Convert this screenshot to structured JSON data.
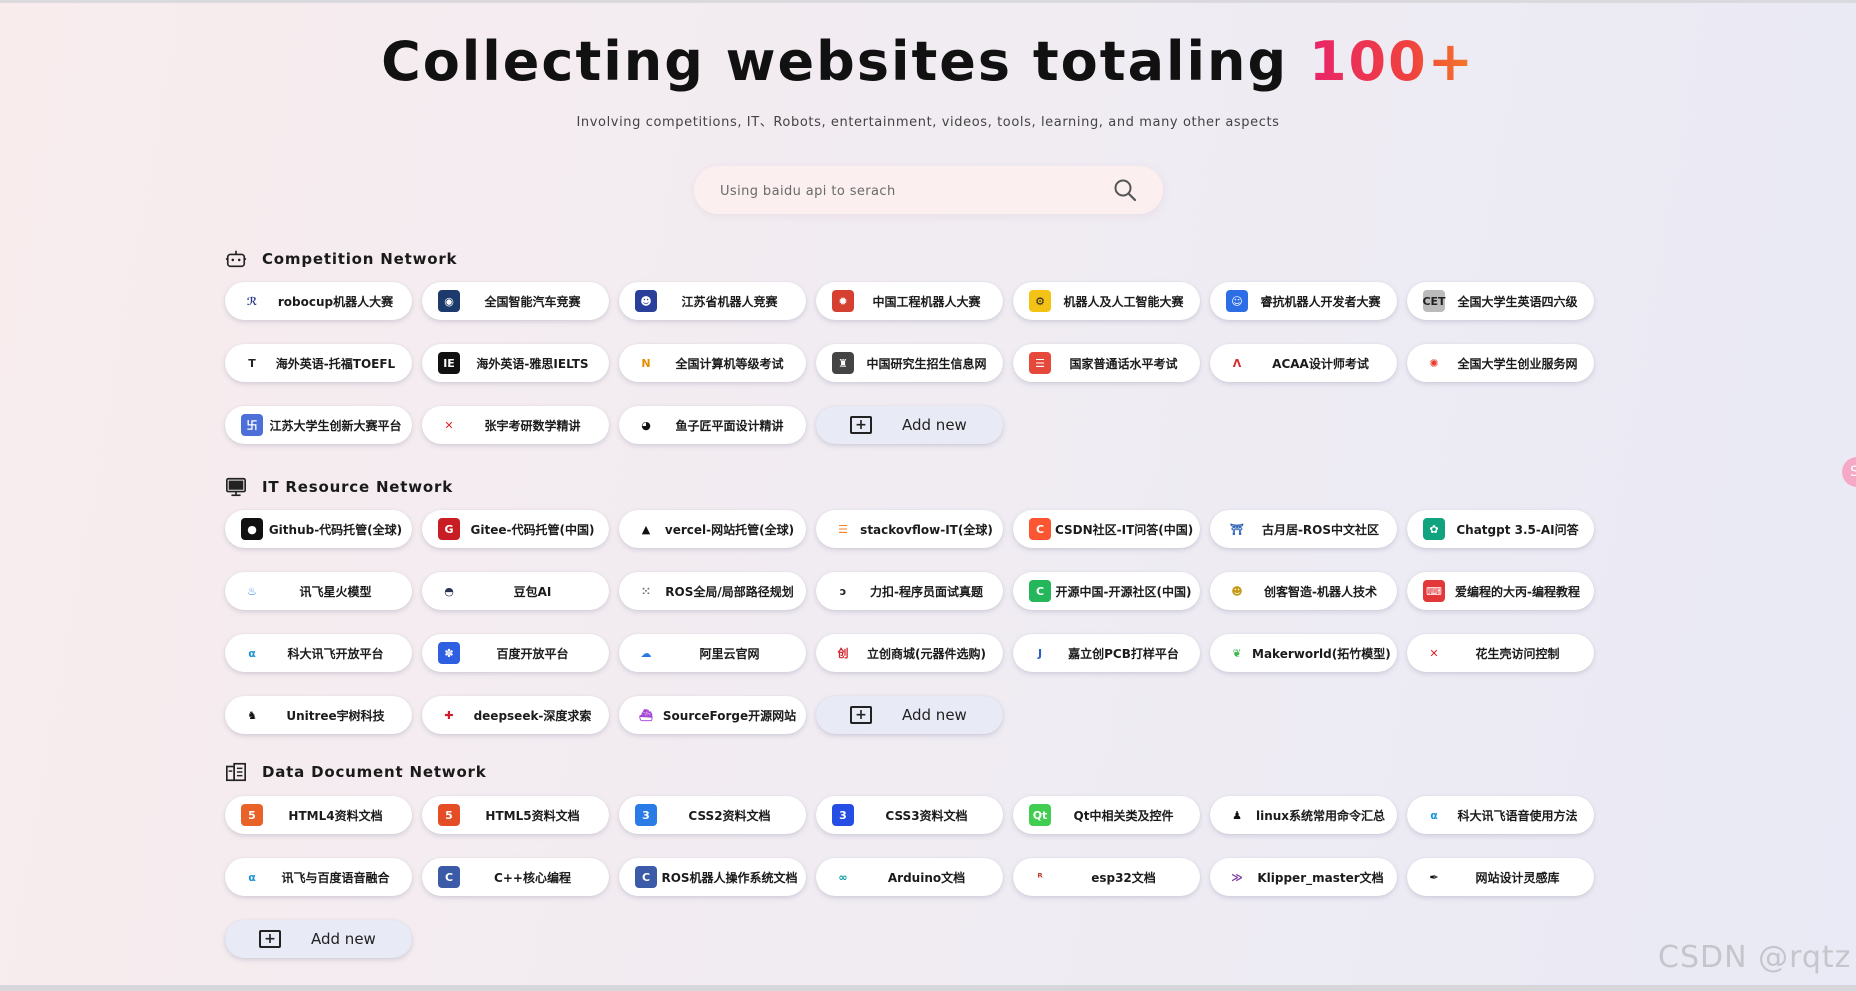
{
  "hero": {
    "title_main": "Collecting websites totaling",
    "title_accent": "100+",
    "subtitle": "Involving competitions, IT、Robots, entertainment, videos, tools, learning, and many other aspects"
  },
  "search": {
    "placeholder": "Using baidu api to serach",
    "value": ""
  },
  "colors": {
    "accent_start": "#e8246a",
    "accent_end": "#f57a27",
    "add_bg": "#e8eaf6"
  },
  "sections": [
    {
      "title": "Competition Network",
      "icon": "robot-icon",
      "cards": [
        {
          "label": "robocup机器人大赛",
          "icon": "robocup-logo-icon"
        },
        {
          "label": "全国智能汽车竞赛",
          "icon": "smartcar-logo-icon"
        },
        {
          "label": "江苏省机器人竞赛",
          "icon": "robot-face-icon"
        },
        {
          "label": "中国工程机器人大赛",
          "icon": "gear-badge-icon"
        },
        {
          "label": "机器人及人工智能大赛",
          "icon": "robot-arm-icon"
        },
        {
          "label": "睿抗机器人开发者大赛",
          "icon": "blue-robot-icon"
        },
        {
          "label": "全国大学生英语四六级",
          "icon": "cet-logo-icon"
        },
        {
          "label": "海外英语-托福TOEFL",
          "icon": "toefl-logo-icon"
        },
        {
          "label": "海外英语-雅思IELTS",
          "icon": "ielts-logo-icon"
        },
        {
          "label": "全国计算机等级考试",
          "icon": "ncre-logo-icon"
        },
        {
          "label": "中国研究生招生信息网",
          "icon": "graduate-icon"
        },
        {
          "label": "国家普通话水平考试",
          "icon": "mandarin-test-icon"
        },
        {
          "label": "ACAA设计师考试",
          "icon": "acaa-logo-icon"
        },
        {
          "label": "全国大学生创业服务网",
          "icon": "bulb-icon"
        },
        {
          "label": "江苏大学生创新大赛平台",
          "icon": "innovation-logo-icon"
        },
        {
          "label": "张宇考研数学精讲",
          "icon": "cross-swords-icon"
        },
        {
          "label": "鱼子匠平面设计精讲",
          "icon": "design-logo-icon"
        }
      ],
      "add_label": "Add new"
    },
    {
      "title": "IT Resource Network",
      "icon": "monitor-icon",
      "cards": [
        {
          "label": "Github-代码托管(全球)",
          "icon": "github-icon"
        },
        {
          "label": "Gitee-代码托管(中国)",
          "icon": "gitee-icon"
        },
        {
          "label": "vercel-网站托管(全球)",
          "icon": "vercel-icon"
        },
        {
          "label": "stackovflow-IT(全球)",
          "icon": "stackoverflow-icon"
        },
        {
          "label": "CSDN社区-IT问答(中国)",
          "icon": "csdn-icon"
        },
        {
          "label": "古月居-ROS中文社区",
          "icon": "guyueju-icon"
        },
        {
          "label": "Chatgpt 3.5-AI问答",
          "icon": "chatgpt-icon"
        },
        {
          "label": "讯飞星火模型",
          "icon": "spark-icon"
        },
        {
          "label": "豆包AI",
          "icon": "doubao-icon"
        },
        {
          "label": "ROS全局/局部路径规划",
          "icon": "dots-grid-icon"
        },
        {
          "label": "力扣-程序员面试真题",
          "icon": "leetcode-icon"
        },
        {
          "label": "开源中国-开源社区(中国)",
          "icon": "oschina-icon"
        },
        {
          "label": "创客智造-机器人技术",
          "icon": "maker-robot-icon"
        },
        {
          "label": "爱编程的大丙-编程教程",
          "icon": "code-screen-icon"
        },
        {
          "label": "科大讯飞开放平台",
          "icon": "iflytek-icon"
        },
        {
          "label": "百度开放平台",
          "icon": "baidu-paw-icon"
        },
        {
          "label": "阿里云官网",
          "icon": "aliyun-cloud-icon"
        },
        {
          "label": "立创商城(元器件选购)",
          "icon": "lcsc-icon"
        },
        {
          "label": "嘉立创PCB打样平台",
          "icon": "jlc-icon"
        },
        {
          "label": "Makerworld(拓竹模型)",
          "icon": "makerworld-leaf-icon"
        },
        {
          "label": "花生壳访问控制",
          "icon": "peanut-icon"
        },
        {
          "label": "Unitree宇树科技",
          "icon": "unitree-dog-icon"
        },
        {
          "label": "deepseek-深度求索",
          "icon": "deepseek-icon"
        },
        {
          "label": "SourceForge开源网站",
          "icon": "sourceforge-ship-icon"
        }
      ],
      "add_label": "Add new"
    },
    {
      "title": "Data Document Network",
      "icon": "document-icon",
      "cards": [
        {
          "label": "HTML4资料文档",
          "icon": "html-icon"
        },
        {
          "label": "HTML5资料文档",
          "icon": "html5-icon"
        },
        {
          "label": "CSS2资料文档",
          "icon": "css-icon"
        },
        {
          "label": "CSS3资料文档",
          "icon": "css3-icon"
        },
        {
          "label": "Qt中相关类及控件",
          "icon": "qt-icon"
        },
        {
          "label": "linux系统常用命令汇总",
          "icon": "linux-penguin-icon"
        },
        {
          "label": "科大讯飞语音使用方法",
          "icon": "iflytek-icon"
        },
        {
          "label": "讯飞与百度语音融合",
          "icon": "iflytek-icon"
        },
        {
          "label": "C++核心编程",
          "icon": "cpp-icon"
        },
        {
          "label": "ROS机器人操作系统文档",
          "icon": "cpp-icon"
        },
        {
          "label": "Arduino文档",
          "icon": "arduino-icon"
        },
        {
          "label": "esp32文档",
          "icon": "rtos-esp32-icon"
        },
        {
          "label": "Klipper_master文档",
          "icon": "klipper-icon"
        },
        {
          "label": "网站设计灵感库",
          "icon": "feather-pen-icon"
        }
      ],
      "add_label": "Add new"
    }
  ],
  "watermark": "CSDN @rqtz"
}
